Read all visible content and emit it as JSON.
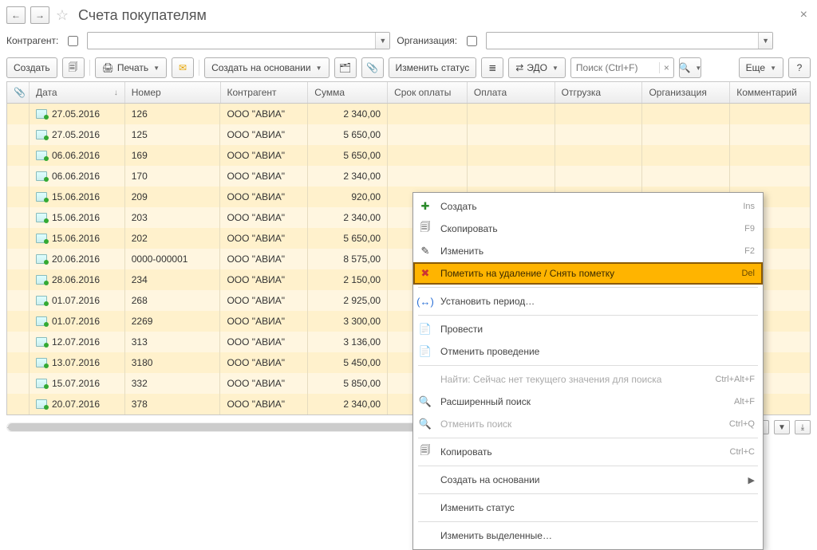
{
  "header": {
    "title": "Счета покупателям"
  },
  "filters": {
    "contragent_label": "Контрагент:",
    "org_label": "Организация:"
  },
  "toolbar": {
    "create": "Создать",
    "print": "Печать",
    "create_based": "Создать на основании",
    "change_status": "Изменить статус",
    "edo": "ЭДО",
    "search_placeholder": "Поиск (Ctrl+F)",
    "more": "Еще"
  },
  "columns": {
    "attach": "",
    "date": "Дата",
    "number": "Номер",
    "ka": "Контрагент",
    "sum": "Сумма",
    "srok": "Срок оплаты",
    "opl": "Оплата",
    "otg": "Отгрузка",
    "org": "Организация",
    "com": "Комментарий"
  },
  "rows": [
    {
      "date": "27.05.2016",
      "number": "126",
      "ka": "ООО \"АВИА\"",
      "sum": "2 340,00"
    },
    {
      "date": "27.05.2016",
      "number": "125",
      "ka": "ООО \"АВИА\"",
      "sum": "5 650,00"
    },
    {
      "date": "06.06.2016",
      "number": "169",
      "ka": "ООО \"АВИА\"",
      "sum": "5 650,00"
    },
    {
      "date": "06.06.2016",
      "number": "170",
      "ka": "ООО \"АВИА\"",
      "sum": "2 340,00"
    },
    {
      "date": "15.06.2016",
      "number": "209",
      "ka": "ООО \"АВИА\"",
      "sum": "920,00"
    },
    {
      "date": "15.06.2016",
      "number": "203",
      "ka": "ООО \"АВИА\"",
      "sum": "2 340,00"
    },
    {
      "date": "15.06.2016",
      "number": "202",
      "ka": "ООО \"АВИА\"",
      "sum": "5 650,00"
    },
    {
      "date": "20.06.2016",
      "number": "0000-000001",
      "ka": "ООО \"АВИА\"",
      "sum": "8 575,00"
    },
    {
      "date": "28.06.2016",
      "number": "234",
      "ka": "ООО \"АВИА\"",
      "sum": "2 150,00"
    },
    {
      "date": "01.07.2016",
      "number": "268",
      "ka": "ООО \"АВИА\"",
      "sum": "2 925,00"
    },
    {
      "date": "01.07.2016",
      "number": "2269",
      "ka": "ООО \"АВИА\"",
      "sum": "3 300,00"
    },
    {
      "date": "12.07.2016",
      "number": "313",
      "ka": "ООО \"АВИА\"",
      "sum": "3 136,00"
    },
    {
      "date": "13.07.2016",
      "number": "3180",
      "ka": "ООО \"АВИА\"",
      "sum": "5 450,00"
    },
    {
      "date": "15.07.2016",
      "number": "332",
      "ka": "ООО \"АВИА\"",
      "sum": "5 850,00"
    },
    {
      "date": "20.07.2016",
      "number": "378",
      "ka": "ООО \"АВИА\"",
      "sum": "2 340,00"
    }
  ],
  "ctx": {
    "create": "Создать",
    "create_sc": "Ins",
    "copy": "Скопировать",
    "copy_sc": "F9",
    "edit": "Изменить",
    "edit_sc": "F2",
    "markdel": "Пометить на удаление / Снять пометку",
    "markdel_sc": "Del",
    "period": "Установить период…",
    "post": "Провести",
    "unpost": "Отменить проведение",
    "find": "Найти: Сейчас нет текущего значения для поиска",
    "find_sc": "Ctrl+Alt+F",
    "advsearch": "Расширенный поиск",
    "advsearch_sc": "Alt+F",
    "cancel_search": "Отменить поиск",
    "cancel_search_sc": "Ctrl+Q",
    "copy2": "Копировать",
    "copy2_sc": "Ctrl+C",
    "create_based2": "Создать на основании",
    "change_status2": "Изменить статус",
    "change_selected": "Изменить выделенные…"
  }
}
